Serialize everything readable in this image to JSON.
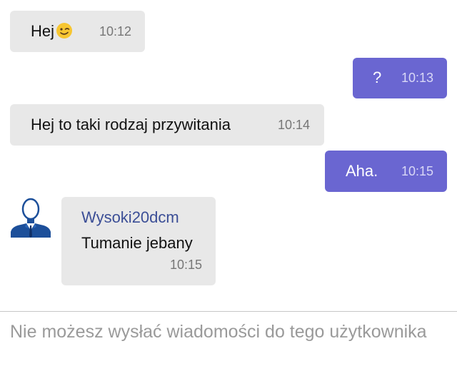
{
  "messages": [
    {
      "direction": "incoming",
      "text": "Hej",
      "emoji": "winking-face-icon",
      "time": "10:12"
    },
    {
      "direction": "outgoing",
      "text": "?",
      "time": "10:13"
    },
    {
      "direction": "incoming",
      "text": "Hej to taki rodzaj przywitania",
      "time": "10:14"
    },
    {
      "direction": "outgoing",
      "text": "Aha.",
      "time": "10:15"
    },
    {
      "direction": "incoming",
      "sender": "Wysoki20dcm",
      "avatar": "user-silhouette-icon",
      "text": "Tumanie jebany",
      "time": "10:15"
    }
  ],
  "composer": {
    "notice": "Nie możesz wysłać wiadomości do tego użytkownika"
  },
  "colors": {
    "incoming_bubble": "#e8e8e8",
    "outgoing_bubble": "#6a66d1",
    "sender_name": "#3b4e96",
    "notice_text": "#9a9a9a"
  }
}
